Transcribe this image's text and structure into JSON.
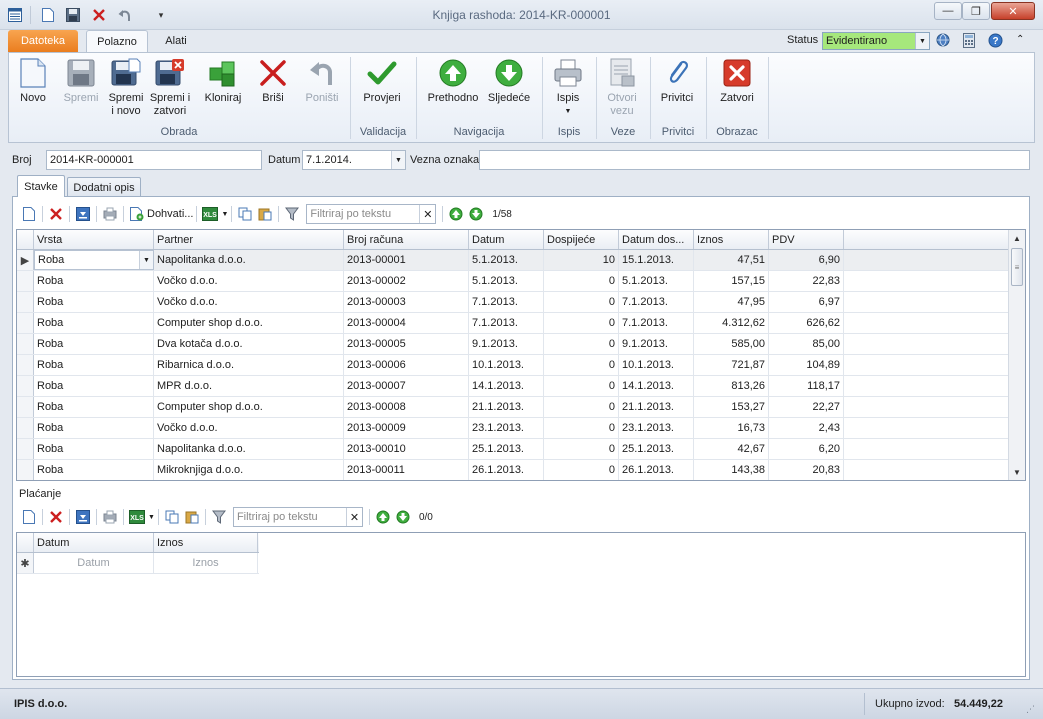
{
  "window": {
    "title": "Knjiga rashoda: 2014-KR-000001",
    "minimize": "—",
    "restore": "❐",
    "close": "✕"
  },
  "ribbon_tabs": {
    "datoteka": "Datoteka",
    "polazno": "Polazno",
    "alati": "Alati"
  },
  "status": {
    "label": "Status",
    "value": "Evidentirano"
  },
  "ribbon": {
    "buttons": {
      "novo": "Novo",
      "spremi": "Spremi",
      "spremi_novo": "Spremi\ni novo",
      "spremi_zatvori": "Spremi i\nzatvori",
      "kloniraj": "Kloniraj",
      "brisi": "Briši",
      "ponisti": "Poništi",
      "provjeri": "Provjeri",
      "prethodno": "Prethodno",
      "sljedece": "Sljedeće",
      "ispis": "Ispis",
      "otvori_vezu": "Otvori\nvezu",
      "privitci": "Privitci",
      "zatvori": "Zatvori"
    },
    "groups": {
      "obrada": "Obrada",
      "validacija": "Validacija",
      "navigacija": "Navigacija",
      "ispis": "Ispis",
      "veze": "Veze",
      "privitci": "Privitci",
      "obrazac": "Obrazac"
    }
  },
  "form": {
    "broj_label": "Broj",
    "broj_value": "2014-KR-000001",
    "datum_label": "Datum",
    "datum_value": "7.1.2014.",
    "vezna_label": "Vezna oznaka",
    "vezna_value": ""
  },
  "tabs": {
    "stavke": "Stavke",
    "dodatni_opis": "Dodatni opis"
  },
  "stavke_toolbar": {
    "dohvati": "Dohvati...",
    "filter_placeholder": "Filtriraj po tekstu",
    "counter": "1/58"
  },
  "stavke_grid": {
    "columns": [
      "Vrsta",
      "Partner",
      "Broj računa",
      "Datum",
      "Dospijeće",
      "Datum dos...",
      "Iznos",
      "PDV"
    ],
    "rows": [
      [
        "Roba",
        "Napolitanka d.o.o.",
        "2013-00001",
        "5.1.2013.",
        "10",
        "15.1.2013.",
        "47,51",
        "6,90"
      ],
      [
        "Roba",
        "Vočko d.o.o.",
        "2013-00002",
        "5.1.2013.",
        "0",
        "5.1.2013.",
        "157,15",
        "22,83"
      ],
      [
        "Roba",
        "Vočko d.o.o.",
        "2013-00003",
        "7.1.2013.",
        "0",
        "7.1.2013.",
        "47,95",
        "6,97"
      ],
      [
        "Roba",
        "Computer shop d.o.o.",
        "2013-00004",
        "7.1.2013.",
        "0",
        "7.1.2013.",
        "4.312,62",
        "626,62"
      ],
      [
        "Roba",
        "Dva kotača d.o.o.",
        "2013-00005",
        "9.1.2013.",
        "0",
        "9.1.2013.",
        "585,00",
        "85,00"
      ],
      [
        "Roba",
        "Ribarnica d.o.o.",
        "2013-00006",
        "10.1.2013.",
        "0",
        "10.1.2013.",
        "721,87",
        "104,89"
      ],
      [
        "Roba",
        "MPR d.o.o.",
        "2013-00007",
        "14.1.2013.",
        "0",
        "14.1.2013.",
        "813,26",
        "118,17"
      ],
      [
        "Roba",
        "Computer shop d.o.o.",
        "2013-00008",
        "21.1.2013.",
        "0",
        "21.1.2013.",
        "153,27",
        "22,27"
      ],
      [
        "Roba",
        "Vočko d.o.o.",
        "2013-00009",
        "23.1.2013.",
        "0",
        "23.1.2013.",
        "16,73",
        "2,43"
      ],
      [
        "Roba",
        "Napolitanka d.o.o.",
        "2013-00010",
        "25.1.2013.",
        "0",
        "25.1.2013.",
        "42,67",
        "6,20"
      ],
      [
        "Roba",
        "Mikroknjiga d.o.o.",
        "2013-00011",
        "26.1.2013.",
        "0",
        "26.1.2013.",
        "143,38",
        "20,83"
      ]
    ]
  },
  "placanje": {
    "title": "Plaćanje",
    "filter_placeholder": "Filtriraj po tekstu",
    "counter": "0/0",
    "columns": [
      "Datum",
      "Iznos"
    ],
    "new_row_placeholders": [
      "Datum",
      "Iznos"
    ]
  },
  "statusbar": {
    "company": "IPIS d.o.o.",
    "total_label": "Ukupno izvod:",
    "total_value": "54.449,22"
  },
  "colors": {
    "status_green": "#a6e87c",
    "accent_orange": "#ea7d1f",
    "close_red": "#d63b2b"
  }
}
